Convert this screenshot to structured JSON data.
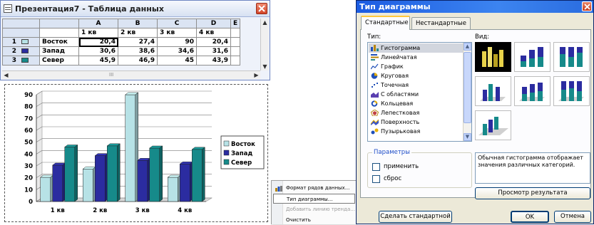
{
  "datasheet": {
    "title": "Презентация7 - Таблица данных",
    "columns": [
      "A",
      "B",
      "C",
      "D",
      "E"
    ],
    "header_row": [
      "1 кв",
      "2 кв",
      "3 кв",
      "4 кв",
      ""
    ],
    "rows": [
      {
        "num": "1",
        "name": "Восток",
        "color": "#b7e2e6",
        "values": [
          "20,4",
          "27,4",
          "90",
          "20,4",
          ""
        ]
      },
      {
        "num": "2",
        "name": "Запад",
        "color": "#2b2ca0",
        "values": [
          "30,6",
          "38,6",
          "34,6",
          "31,6",
          ""
        ]
      },
      {
        "num": "3",
        "name": "Север",
        "color": "#168a8a",
        "values": [
          "45,9",
          "46,9",
          "45",
          "43,9",
          ""
        ]
      }
    ],
    "hscroll_mark": "III"
  },
  "chart_data": {
    "type": "bar",
    "categories": [
      "1 кв",
      "2 кв",
      "3 кв",
      "4 кв"
    ],
    "series": [
      {
        "name": "Восток",
        "color": "#b7e2e6",
        "values": [
          20.4,
          27.4,
          90,
          20.4
        ]
      },
      {
        "name": "Запад",
        "color": "#2b2ca0",
        "values": [
          30.6,
          38.6,
          34.6,
          31.6
        ]
      },
      {
        "name": "Север",
        "color": "#168a8a",
        "values": [
          45.9,
          46.9,
          45,
          43.9
        ]
      }
    ],
    "ylim": [
      0,
      90
    ],
    "yticks": [
      "0",
      "10",
      "20",
      "30",
      "40",
      "50",
      "60",
      "70",
      "80",
      "90"
    ],
    "grid": true,
    "legend": "right",
    "style": "3d-column"
  },
  "context_menu": {
    "items": [
      {
        "label": "Формат рядов данных...",
        "icon": "format-series-icon",
        "state": "normal"
      },
      {
        "label": "Тип диаграммы...",
        "icon": "",
        "state": "hover"
      },
      {
        "label": "Добавить линию тренда...",
        "icon": "",
        "state": "disabled"
      },
      {
        "label": "Очистить",
        "icon": "",
        "state": "normal"
      }
    ]
  },
  "dialog": {
    "title": "Тип диаграммы",
    "tabs": [
      "Стандартные",
      "Нестандартные"
    ],
    "active_tab": 0,
    "type_label": "Тип:",
    "view_label": "Вид:",
    "chart_types": [
      {
        "label": "Гистограмма",
        "icon": "column-chart-icon",
        "selected": true
      },
      {
        "label": "Линейчатая",
        "icon": "bar-chart-icon",
        "selected": false
      },
      {
        "label": "График",
        "icon": "line-chart-icon",
        "selected": false
      },
      {
        "label": "Круговая",
        "icon": "pie-chart-icon",
        "selected": false
      },
      {
        "label": "Точечная",
        "icon": "scatter-chart-icon",
        "selected": false
      },
      {
        "label": "С областями",
        "icon": "area-chart-icon",
        "selected": false
      },
      {
        "label": "Кольцевая",
        "icon": "doughnut-chart-icon",
        "selected": false
      },
      {
        "label": "Лепестковая",
        "icon": "radar-chart-icon",
        "selected": false
      },
      {
        "label": "Поверхность",
        "icon": "surface-chart-icon",
        "selected": false
      },
      {
        "label": "Пузырьковая",
        "icon": "bubble-chart-icon",
        "selected": false
      }
    ],
    "params_label": "Параметры",
    "checkboxes": [
      {
        "label": "применить",
        "checked": false
      },
      {
        "label": "сброс",
        "checked": false
      }
    ],
    "description": "Обычная гистограмма отображает значения различных категорий.",
    "preview_button": "Просмотр результата",
    "make_default_button": "Сделать стандартной",
    "ok_button": "OK",
    "cancel_button": "Отмена"
  },
  "colors": {
    "accent": "#2a6cdf",
    "series_east": "#b7e2e6",
    "series_west": "#2b2ca0",
    "series_north": "#168a8a"
  }
}
